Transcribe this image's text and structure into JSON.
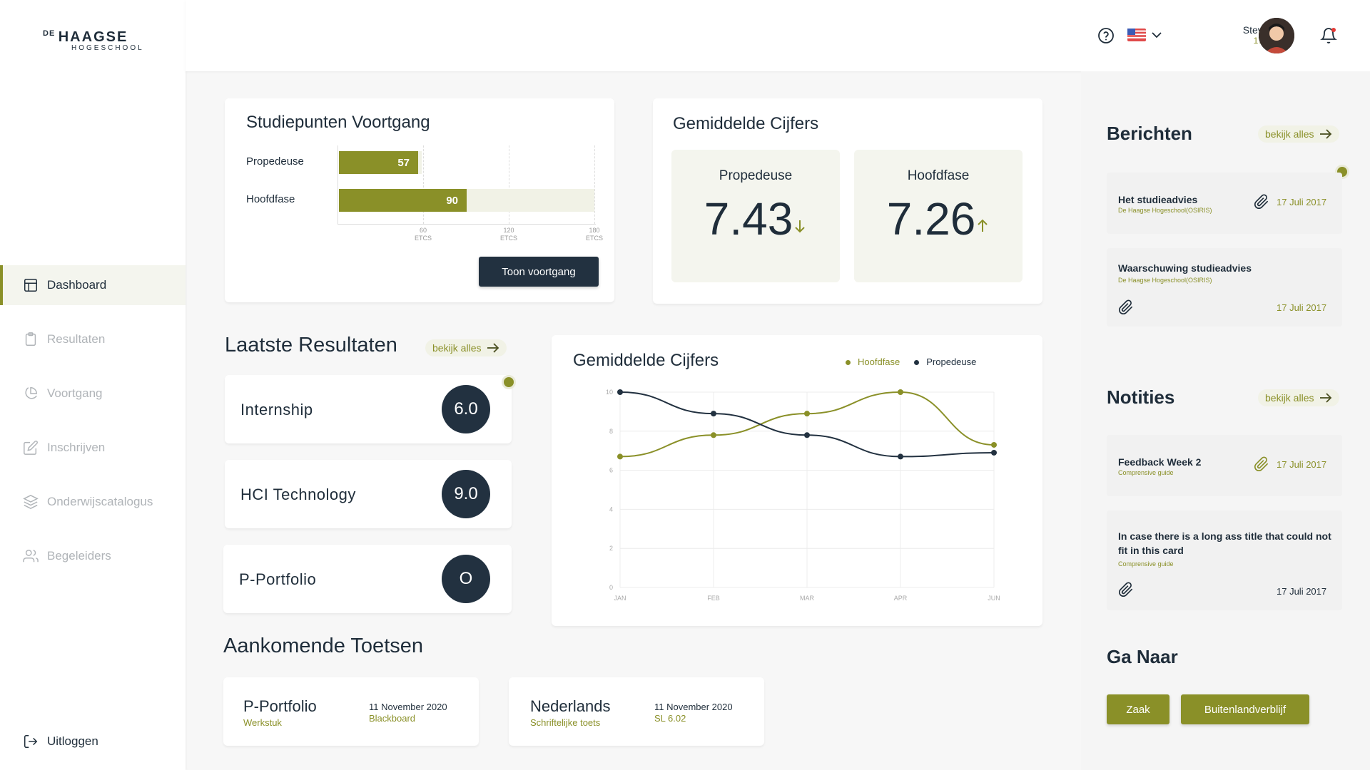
{
  "sidebar": {
    "logo": {
      "prefix": "DE",
      "name": "HAAGSE",
      "sub": "HOGESCHOOL"
    },
    "items": [
      {
        "label": "Dashboard",
        "icon": "layout-icon"
      },
      {
        "label": "Resultaten",
        "icon": "clipboard-icon"
      },
      {
        "label": "Voortgang",
        "icon": "pie-chart-icon"
      },
      {
        "label": "Inschrijven",
        "icon": "edit-icon"
      },
      {
        "label": "Onderwijscatalogus",
        "icon": "layers-icon"
      },
      {
        "label": "Begeleiders",
        "icon": "users-icon"
      }
    ],
    "logout": "Uitloggen"
  },
  "header": {
    "user_name": "Steven Wu",
    "user_id": "17025338",
    "language": "en-US",
    "notification_dot_color": "#e53935"
  },
  "colors": {
    "accent": "#8a9028",
    "dark": "#223140"
  },
  "progress": {
    "title": "Studiepunten Voortgang",
    "rows": [
      {
        "label": "Propedeuse",
        "value": "57",
        "fraction": 0.95,
        "max_fraction": 0.33
      },
      {
        "label": "Hoofdfase",
        "value": "90",
        "fraction": 0.5,
        "max_fraction": 1.0
      }
    ],
    "ticks": [
      {
        "value": "60",
        "unit": "ETCS"
      },
      {
        "value": "120",
        "unit": "ETCS"
      },
      {
        "value": "180",
        "unit": "ETCS"
      }
    ],
    "button": "Toon voortgang"
  },
  "avg": {
    "title": "Gemiddelde Cijfers",
    "propedeuse": {
      "label": "Propedeuse",
      "value": "7.43",
      "trend": "down"
    },
    "hoofdfase": {
      "label": "Hoofdfase",
      "value": "7.26",
      "trend": "up"
    }
  },
  "results": {
    "title": "Laatste Resultaten",
    "link": "bekijk alles",
    "items": [
      {
        "name": "Internship",
        "grade": "6.0",
        "new": true
      },
      {
        "name": "HCI Technology",
        "grade": "9.0",
        "new": false
      },
      {
        "name": "P-Portfolio",
        "grade": "O",
        "new": false
      }
    ]
  },
  "chart_title": "Gemiddelde Cijfers",
  "chart_data": {
    "type": "line",
    "x": [
      "JAN",
      "FEB",
      "MAR",
      "APR",
      "JUN"
    ],
    "series": [
      {
        "name": "Hoofdfase",
        "values": [
          6.7,
          7.8,
          8.9,
          10.0,
          7.3
        ],
        "color": "#8a9028"
      },
      {
        "name": "Propedeuse",
        "values": [
          10.0,
          8.9,
          7.8,
          6.7,
          6.9
        ],
        "color": "#223140"
      }
    ],
    "yticks": [
      0,
      2,
      4,
      6,
      8,
      10
    ],
    "ylim": [
      0,
      10
    ],
    "grid": true,
    "legend": "top-right",
    "smooth": true
  },
  "exams": {
    "title": "Aankomende Toetsen",
    "items": [
      {
        "name": "P-Portfolio",
        "type": "Werkstuk",
        "date": "11 November 2020",
        "location": "Blackboard"
      },
      {
        "name": "Nederlands",
        "type": "Schriftelijke toets",
        "date": "11 November 2020",
        "location": "SL 6.02"
      }
    ]
  },
  "messages": {
    "title": "Berichten",
    "link": "bekijk alles",
    "items": [
      {
        "title": "Het studieadvies",
        "source": "De Haagse Hogeschool(OSIRIS)",
        "date": "17 Juli 2017"
      },
      {
        "title": "Waarschuwing studieadvies",
        "source": "De Haagse Hogeschool(OSIRIS)",
        "date": "17 Juli 2017"
      }
    ]
  },
  "notes": {
    "title": "Notities",
    "link": "bekijk alles",
    "items": [
      {
        "title": "Feedback Week 2",
        "source": "Comprensive guide",
        "date": "17 Juli 2017"
      },
      {
        "title": "In case there is a long ass title that could not fit in this card",
        "source": "Comprensive guide",
        "date": "17 Juli 2017"
      }
    ]
  },
  "goto": {
    "title": "Ga Naar",
    "buttons": [
      "Zaak",
      "Buitenlandverblijf"
    ]
  }
}
